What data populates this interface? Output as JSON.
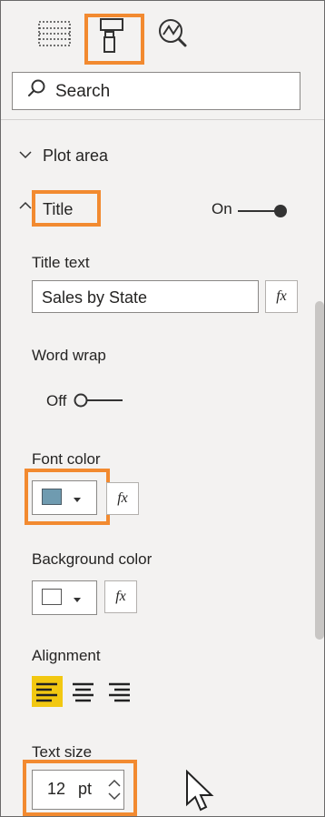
{
  "toolbar": {
    "fields_icon": "fields-table-icon",
    "format_icon": "paint-roller-icon",
    "analytics_icon": "analytics-magnifier-icon"
  },
  "search": {
    "placeholder": "Search"
  },
  "sections": {
    "plot_area": "Plot area",
    "title": "Title"
  },
  "title_toggle": {
    "label": "On"
  },
  "fields": {
    "title_text_label": "Title text",
    "title_text_value": "Sales by State",
    "word_wrap_label": "Word wrap",
    "word_wrap_value": "Off",
    "font_color_label": "Font color",
    "background_color_label": "Background color",
    "alignment_label": "Alignment",
    "text_size_label": "Text size",
    "text_size_value": "12",
    "text_size_unit": "pt",
    "fx": "fx"
  },
  "colors": {
    "accent": "#f28a30",
    "font_color_swatch": "#6f9bb0",
    "background_color_swatch": "#ffffff",
    "alignment_active": "#f2c811"
  }
}
